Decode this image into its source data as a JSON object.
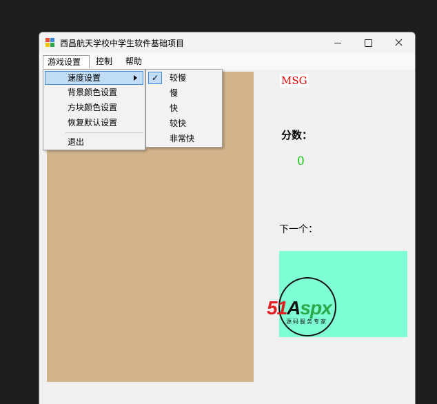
{
  "window": {
    "title": "西昌航天学校中学生软件基础项目",
    "controls": {
      "minimize_icon": "minimize-icon",
      "maximize_icon": "maximize-icon",
      "close_icon": "close-icon"
    }
  },
  "menubar": {
    "items": [
      {
        "label": "游戏设置"
      },
      {
        "label": "控制"
      },
      {
        "label": "帮助"
      }
    ]
  },
  "dropdown": {
    "items": [
      {
        "label": "速度设置",
        "has_submenu": true
      },
      {
        "label": "背景颜色设置"
      },
      {
        "label": "方块颜色设置"
      },
      {
        "label": "恢复默认设置"
      },
      {
        "label": "退出"
      }
    ]
  },
  "speed_submenu": {
    "items": [
      {
        "label": "较慢",
        "checked": true
      },
      {
        "label": "慢"
      },
      {
        "label": "快"
      },
      {
        "label": "较快"
      },
      {
        "label": "非常快"
      }
    ],
    "check_mark": "✓"
  },
  "panel": {
    "msg": "MSG",
    "score_label": "分数：",
    "score_value": "0",
    "next_label": "下一个："
  },
  "watermark": {
    "brand_prefix": "51",
    "brand_mid": "A",
    "brand_suffix": "spx",
    "tagline": "源码服务专家"
  },
  "colors": {
    "board": "#d2b48c",
    "next_box": "#7fffd4",
    "msg_text": "#e00000",
    "score_text": "#11cc11",
    "highlight": "#c1dcf5"
  }
}
